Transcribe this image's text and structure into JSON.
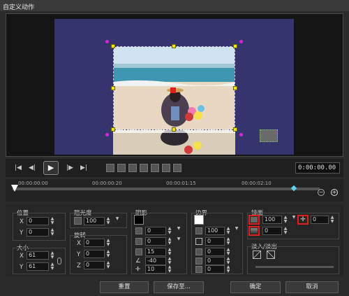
{
  "window": {
    "title": "自定义动作"
  },
  "transport": {
    "timecode": "0:00:00.00",
    "buttons": [
      "home",
      "prev-frame",
      "play",
      "next-frame",
      "end"
    ]
  },
  "timeline": {
    "ticks": [
      "00:00:00:00",
      "00:00:00:20",
      "00:00:01:15",
      "00:00:02:10"
    ],
    "zoom_out_icon": "zoom-out-icon",
    "zoom_in_icon": "zoom-in-icon"
  },
  "position": {
    "title": "位置",
    "x_label": "X",
    "x_value": "0",
    "y_label": "Y",
    "y_value": "0"
  },
  "size": {
    "title": "大小",
    "x_label": "X",
    "x_value": "61",
    "y_label": "Y",
    "y_value": "61"
  },
  "opacity": {
    "title": "阻光度",
    "value": "100"
  },
  "rotation": {
    "title": "旋转",
    "x_label": "X",
    "x_value": "0",
    "y_label": "Y",
    "y_value": "0",
    "z_label": "Z",
    "z_value": "0"
  },
  "shadow": {
    "title": "阴影",
    "v1": "0",
    "v2": "0",
    "v3": "15",
    "v4": "-40",
    "v5": "10"
  },
  "border": {
    "title": "边界",
    "v1": "100",
    "v2": "0",
    "v3": "0",
    "v4": "0",
    "v5": "0"
  },
  "mirror": {
    "title": "镜面",
    "opacity": "100",
    "gap": "0",
    "fade": "0"
  },
  "fade": {
    "title": "淡入/淡出"
  },
  "footer": {
    "reset": "重置",
    "save_to": "保存至...",
    "ok": "确定",
    "cancel": "取消"
  },
  "colors": {
    "canvas": "#36346e",
    "handle": "#f2e600",
    "highlight": "#e02020"
  }
}
